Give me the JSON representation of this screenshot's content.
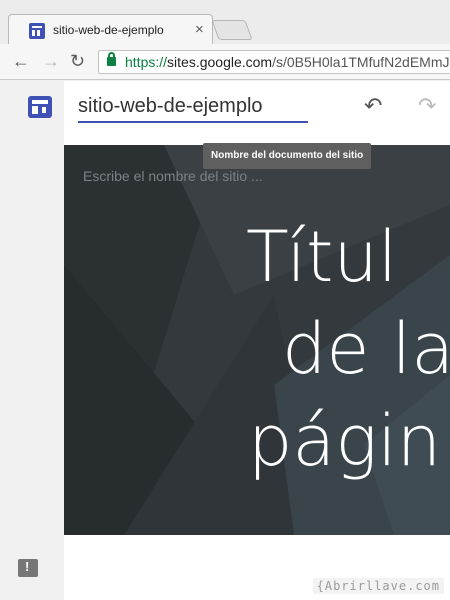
{
  "browser": {
    "tab_title": "sitio-web-de-ejemplo",
    "tab_close": "×",
    "back": "←",
    "forward": "→",
    "reload": "↻",
    "url_proto": "https://",
    "url_host": "sites.google.com",
    "url_path": "/s/0B5H0la1TMfufN2dEMmJ"
  },
  "editor": {
    "site_title_value": "sitio-web-de-ejemplo",
    "undo": "↶",
    "redo": "↷",
    "tooltip": "Nombre del documento del sitio"
  },
  "hero": {
    "site_name_placeholder": "Escribe el nombre del sitio ...",
    "title_lines": [
      "Títul",
      "de la",
      "págin"
    ]
  },
  "watermark": "{Abrirllave.com"
}
